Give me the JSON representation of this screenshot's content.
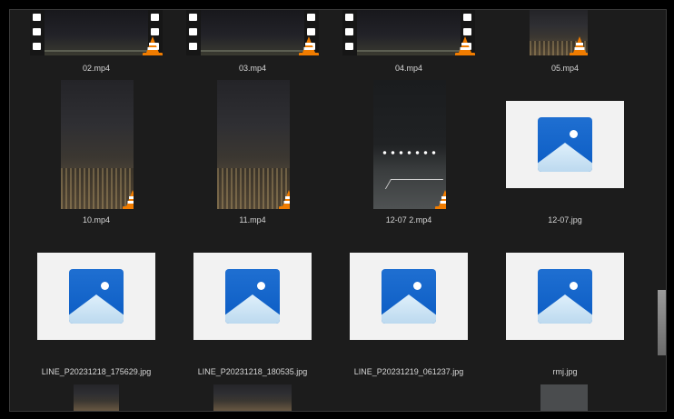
{
  "files": {
    "row1": [
      {
        "name": "02.mp4"
      },
      {
        "name": "03.mp4"
      },
      {
        "name": "04.mp4"
      },
      {
        "name": "05.mp4"
      }
    ],
    "row2": [
      {
        "name": "10.mp4"
      },
      {
        "name": "11.mp4"
      },
      {
        "name": "12-07 2.mp4"
      },
      {
        "name": "12-07.jpg"
      }
    ],
    "row3": [
      {
        "name": "LINE_P20231218_175629.jpg"
      },
      {
        "name": "LINE_P20231218_180535.jpg"
      },
      {
        "name": "LINE_P20231219_061237.jpg"
      },
      {
        "name": "rmj.jpg"
      }
    ]
  },
  "icons": {
    "video": "vlc-cone-icon",
    "image": "photo-placeholder-icon"
  },
  "colors": {
    "background": "#1c1c1c",
    "text": "#d6d6d6",
    "photo_icon": "#0b5cc4",
    "cone": "#f07c00"
  }
}
